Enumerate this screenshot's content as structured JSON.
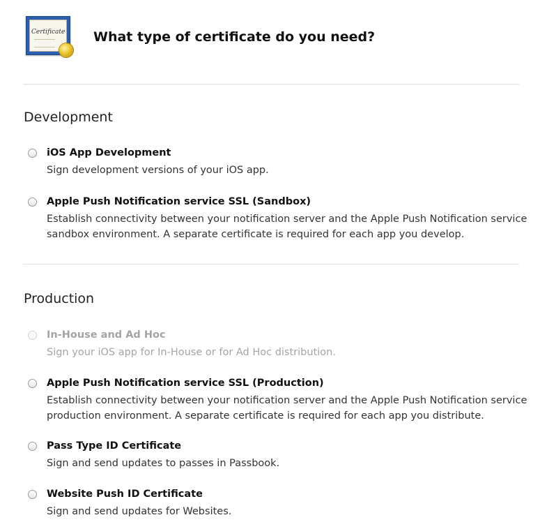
{
  "header": {
    "icon_label": "Certificate",
    "title": "What type of certificate do you need?"
  },
  "sections": [
    {
      "title": "Development",
      "options": [
        {
          "title": "iOS App Development",
          "description": "Sign development versions of your iOS app.",
          "enabled": true,
          "selected": false
        },
        {
          "title": "Apple Push Notification service SSL (Sandbox)",
          "description": "Establish connectivity between your notification server and the Apple Push Notification service sandbox environment. A separate certificate is required for each app you develop.",
          "enabled": true,
          "selected": false
        }
      ]
    },
    {
      "title": "Production",
      "options": [
        {
          "title": "In-House and Ad Hoc",
          "description": "Sign your iOS app for In-House or for Ad Hoc distribution.",
          "enabled": false,
          "selected": false
        },
        {
          "title": "Apple Push Notification service SSL (Production)",
          "description": "Establish connectivity between your notification server and the Apple Push Notification service production environment. A separate certificate is required for each app you distribute.",
          "enabled": true,
          "selected": false
        },
        {
          "title": "Pass Type ID Certificate",
          "description": "Sign and send updates to passes in Passbook.",
          "enabled": true,
          "selected": false
        },
        {
          "title": "Website Push ID Certificate",
          "description": "Sign and send updates for Websites.",
          "enabled": true,
          "selected": false
        }
      ]
    }
  ]
}
